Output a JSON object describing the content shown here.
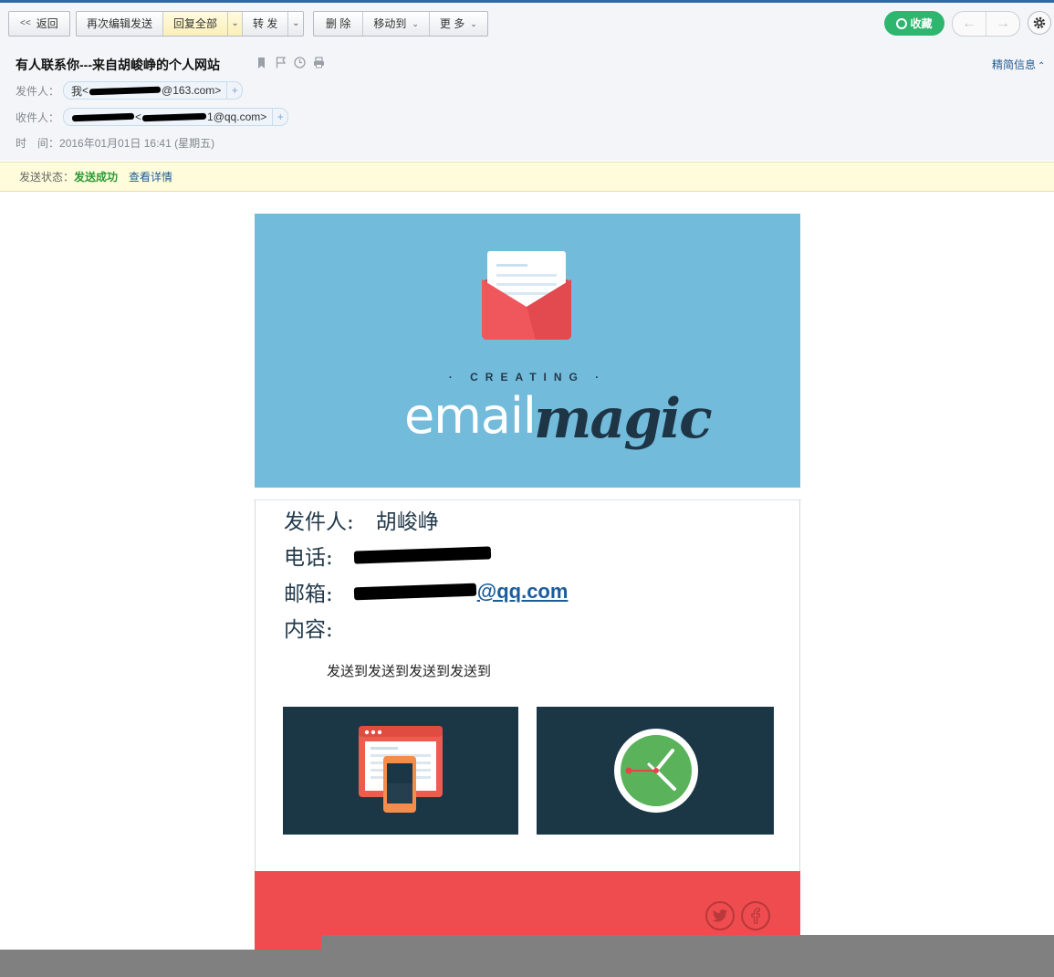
{
  "toolbar": {
    "back": "返回",
    "resend": "再次编辑发送",
    "reply_all": "回复全部",
    "forward": "转 发",
    "delete": "删 除",
    "move_to": "移动到",
    "more": "更 多",
    "favorite": "收藏",
    "brief_info": "精简信息"
  },
  "mail": {
    "subject": "有人联系你---来自胡峻峥的个人网站",
    "sender_label": "发件人：",
    "sender_name": "我",
    "sender_domain": "@163.com>",
    "recipient_label": "收件人：",
    "recipient_domain": "1@qq.com>",
    "time_label": "时　间：",
    "time_value": "2016年01月01日 16:41 (星期五)"
  },
  "status": {
    "label": "发送状态：",
    "value": "发送成功",
    "detail_link": "查看详情"
  },
  "hero": {
    "subtitle": "· CREATING ·",
    "title_light": "email",
    "title_bold": "magic"
  },
  "body": {
    "from_label": "发件人:",
    "from_value": "胡峻峥",
    "phone_label": "电话:",
    "email_label": "邮箱:",
    "email_domain": "@qq.com",
    "content_label": "内容:",
    "message": "发送到发送到发送到发送到"
  },
  "colors": {
    "hero_bg": "#72bbdb",
    "tile_bg": "#1b3746",
    "footer_bg": "#ef4c4f",
    "success_green": "#2c9a36",
    "favorite_green": "#2eb66f"
  },
  "icons": [
    "back-icon",
    "dropdown-icon",
    "favorite-icon",
    "prev-arrow-icon",
    "next-arrow-icon",
    "settings-gear-icon",
    "bookmark-icon",
    "flag-icon",
    "clock-icon",
    "print-icon",
    "add-recipient-icon",
    "envelope-icon",
    "responsive-devices-icon",
    "clock-tile-icon",
    "twitter-icon",
    "facebook-icon"
  ]
}
